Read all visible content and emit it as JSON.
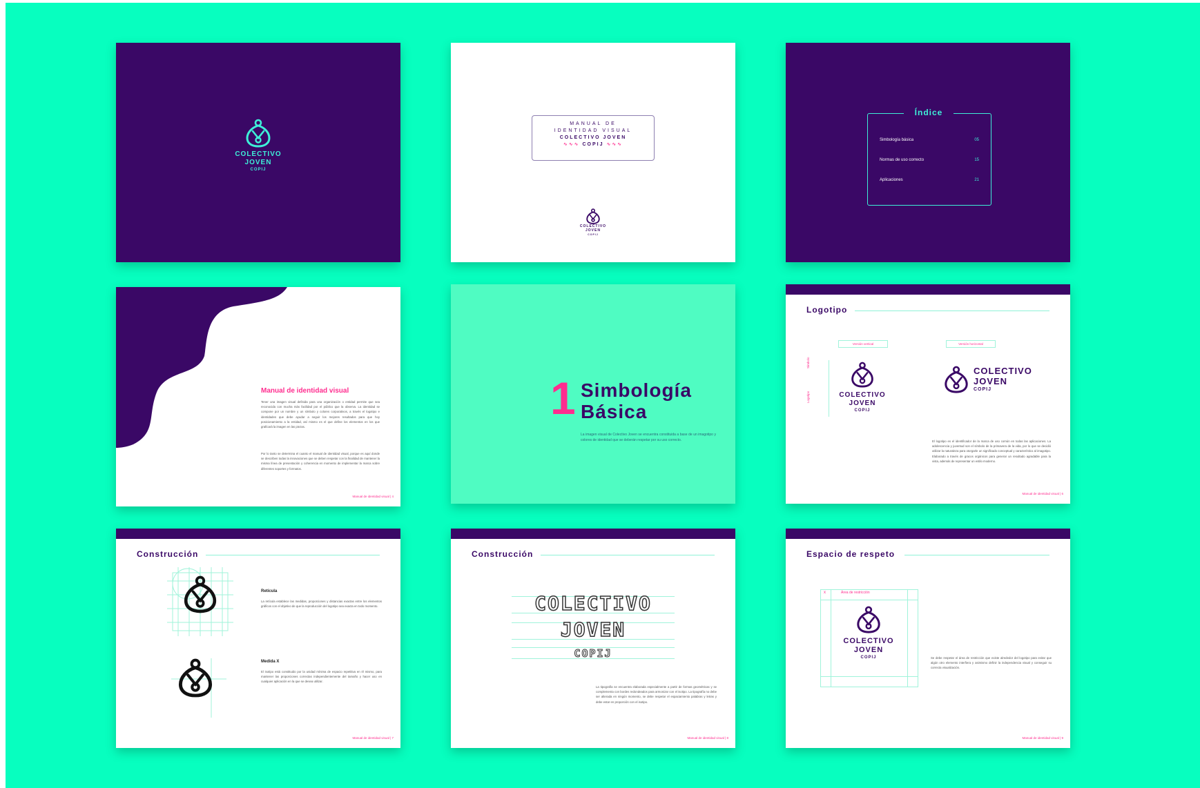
{
  "colors": {
    "background": "#07ffbf",
    "purple": "#3a0866",
    "mint": "#4ffcc2",
    "pink": "#ff2d8f",
    "logo_cyan": "#3ef0d8"
  },
  "logo": {
    "line1": "COLECTIVO",
    "line2": "JOVEN",
    "line3": "COPIJ",
    "icon": "drop-figure-icon"
  },
  "slides": {
    "cover": {},
    "title": {
      "line1": "MANUAL DE",
      "line2": "IDENTIDAD VISUAL",
      "line3": "COLECTIVO JOVEN",
      "line4": "COPIJ"
    },
    "index": {
      "title": "Índice",
      "items": [
        {
          "label": "Simbología básica",
          "page": "05"
        },
        {
          "label": "Normas de uso correcto",
          "page": "15"
        },
        {
          "label": "Aplicaciones",
          "page": "21"
        }
      ]
    },
    "intro": {
      "title": "Manual de identidad visual",
      "p1": "Tener una imagen visual definida para una organización o entidad permite que sea reconocida con mucha más facilidad por el público que la observa. La identidad se compone por un nombre y un símbolo y colores corporativos, a través el logotipo e identidades que debe ayudar a seguir los mejores resultados para que hoy posicionamiento a la entidad, así mismo es el que define los elementos en los que graficará la imagen en las piezas.",
      "p2": "Por lo tanto se determina el cuanto el manual de identidad visual, porque es aquí donde se describen todas la innovaciones que se deben respetar con la finalidad de mantener la misma línea de presentación y coherencia en momento de implementar la marca sobre diferentes soportes y formatos.",
      "footer": "Manual de identidad visual  |  4"
    },
    "chapter": {
      "number": "1",
      "title1": "Simbología",
      "title2": "Básica",
      "body": "La imagen visual de Colectivo Joven se encuentra constituida a base de un imagotipo y colores de identidad que se deberán respetar por su uso correcto."
    },
    "logotipo": {
      "title": "Logotipo",
      "label_vertical": "Versión vertical",
      "label_horizontal": "Versión horizontal",
      "side1": "Símbolo",
      "side2": "Logotipo",
      "body": "El logotipo es el identificador de la marca de uso común en todas las aplicaciones. La adolescencia y juventud son el símbolo de la primavera de la vida, por lo que se decidió utilizar la naturaleza para otorgarle un significado conceptual y característico al imagotipo. Elaborado a través de gracos orgánicos para generar un resultado agradable para la vista, además de representar un estilo moderno.",
      "footer": "Manual de identidad visual  |  6"
    },
    "construccion1": {
      "title": "Construcción",
      "h1": "Retícula",
      "p1": "La retícula establece las medidas, proporciones y distancias exactas entre los elementos gráficos con el objetivo de que la reproducción del logotipo sea exacta en todo momento.",
      "h2": "Medida X",
      "p2": "El isotipo está constituido por la unidad mínima de espacio repetitiva en él mismo, para mantener las proporciones correctas independientemente del tamaño y hacer uso en cualquier aplicación en la que se desea utilizar.",
      "footer": "Manual de identidad visual  |  7"
    },
    "construccion2": {
      "title": "Construcción",
      "w1": "COLECTIVO",
      "w2": "JOVEN",
      "w3": "COPIJ",
      "body": "La tipografía se encuentra elaborada especialmente a partir de formas geométricas y se complementa con bordes redondeados para armonizar con el isotipo. La tipografía no debe ser alterada en ningún momento, se debe respetar el espaciamiento palabras y letras y debe estar en proporción con el isotipo.",
      "footer": "Manual de identidad visual  |  8"
    },
    "respeto": {
      "title": "Espacio de respeto",
      "marker": "x",
      "area_label": "Área de restricción",
      "body": "Se debe respetar el área de restricción que existe alrededor del logotipo para evitar que algún otro elemento interfiera y asimismo definir la independencia visual y conseguir su correcta visualización.",
      "footer": "Manual de identidad visual  |  9"
    }
  }
}
